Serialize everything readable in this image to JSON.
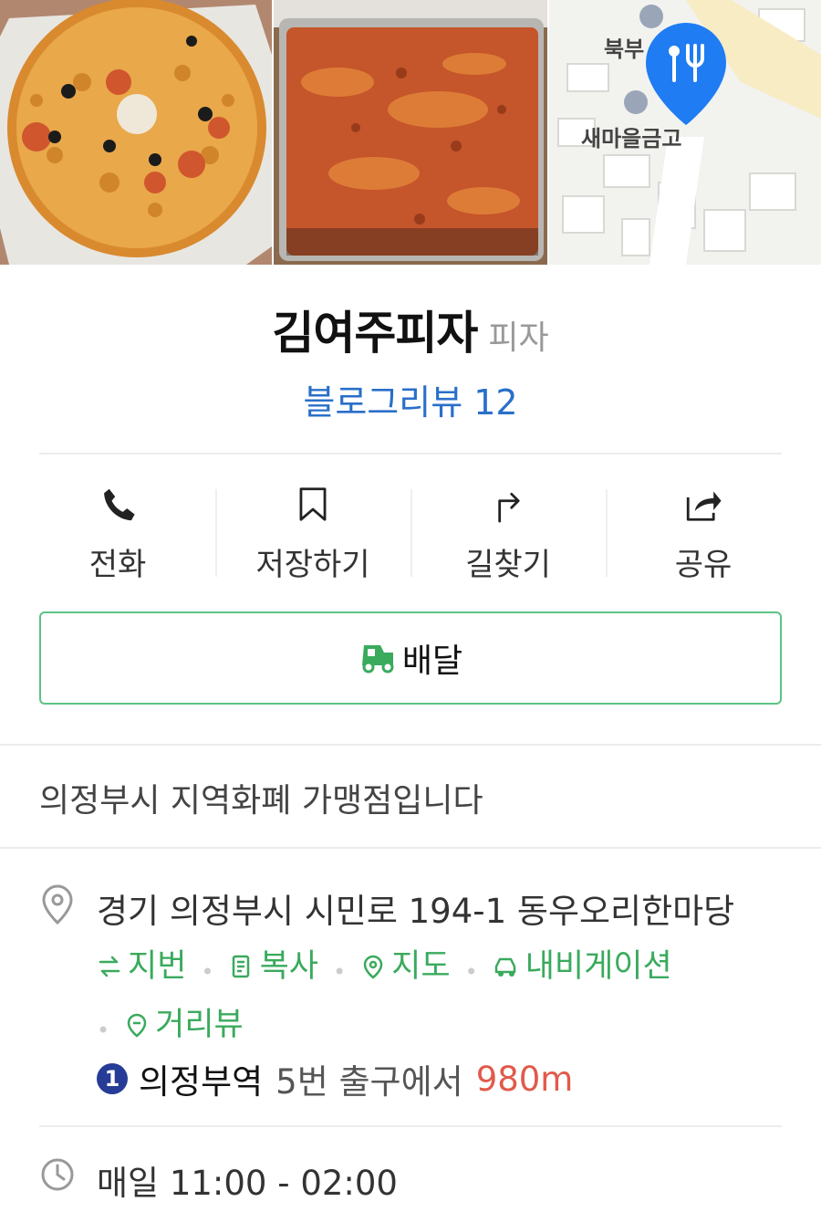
{
  "photos": [
    {
      "name": "pizza-photo"
    },
    {
      "name": "tteokbokki-photo"
    },
    {
      "name": "map-thumbnail"
    }
  ],
  "map": {
    "labels": [
      "북부",
      "새마을금고"
    ],
    "pin_color": "#1f7cf2"
  },
  "place": {
    "name": "김여주피자",
    "category": "피자",
    "review_link": "블로그리뷰 12"
  },
  "actions": [
    {
      "label": "전화",
      "icon": "phone-icon"
    },
    {
      "label": "저장하기",
      "icon": "bookmark-icon"
    },
    {
      "label": "길찾기",
      "icon": "directions-icon"
    },
    {
      "label": "공유",
      "icon": "share-icon"
    }
  ],
  "delivery": {
    "label": "배달",
    "icon": "delivery-truck-icon"
  },
  "notice": "의정부시 지역화폐 가맹점입니다",
  "address": {
    "text": "경기 의정부시 시민로 194-1 동우오리한마당",
    "links": [
      {
        "label": "지번",
        "icon": "swap-icon"
      },
      {
        "label": "복사",
        "icon": "copy-icon"
      },
      {
        "label": "지도",
        "icon": "map-pin-icon"
      },
      {
        "label": "내비게이션",
        "icon": "car-icon"
      },
      {
        "label": "거리뷰",
        "icon": "street-view-icon"
      }
    ]
  },
  "subway": {
    "line": "1",
    "station": "의정부역",
    "exit": "5번 출구에서",
    "distance": "980m"
  },
  "hours": "매일 11:00 - 02:00",
  "colors": {
    "accent_green": "#3aaa5d",
    "link_blue": "#2a6fc9",
    "distance_red": "#e15a4a",
    "line1_blue": "#263c96"
  }
}
